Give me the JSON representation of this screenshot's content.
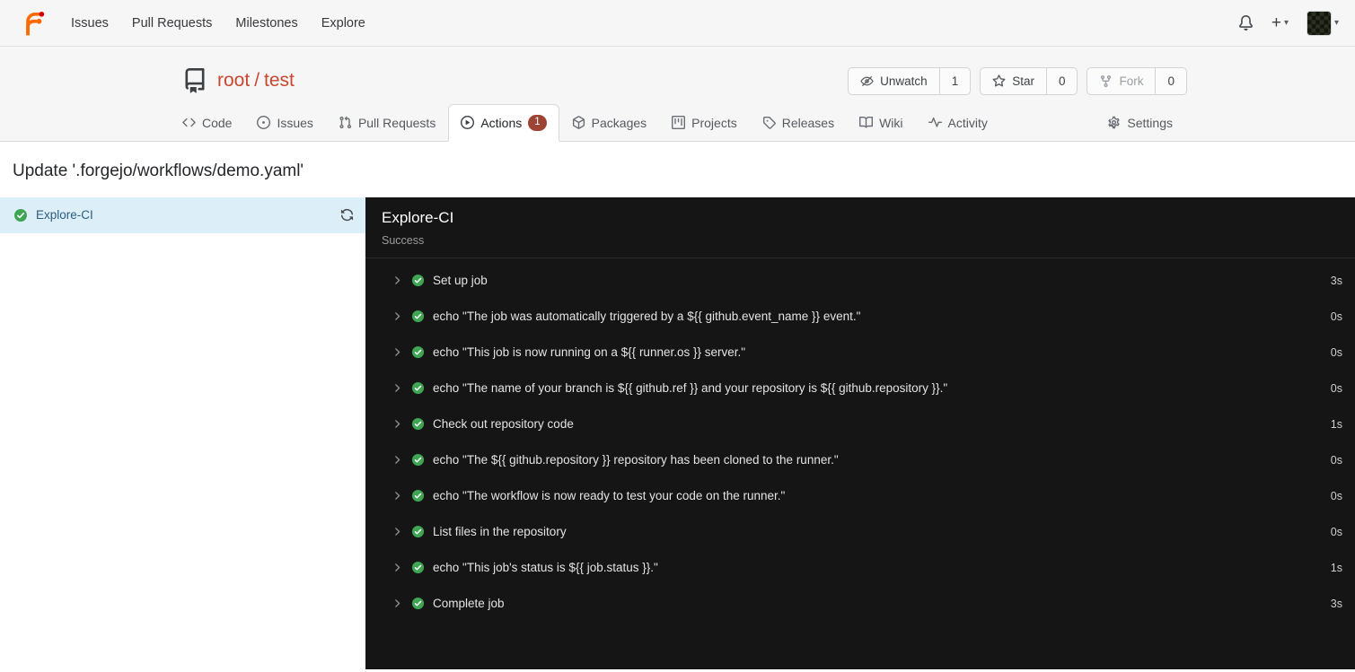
{
  "colors": {
    "accent": "#c8472f",
    "success_green": "#3fa553",
    "selected_job_bg": "#dceff9",
    "log_panel_bg": "#151515"
  },
  "icons": {
    "plus": "+",
    "caret_down": "▾"
  },
  "navbar": {
    "items": [
      {
        "label": "Issues"
      },
      {
        "label": "Pull Requests"
      },
      {
        "label": "Milestones"
      },
      {
        "label": "Explore"
      }
    ]
  },
  "repo_header": {
    "owner": "root",
    "slash": "/",
    "name": "test",
    "buttons": [
      {
        "label": "Unwatch",
        "count": "1"
      },
      {
        "label": "Star",
        "count": "0"
      },
      {
        "label": "Fork",
        "count": "0",
        "disabled": true
      }
    ],
    "tabs": [
      {
        "label": "Code"
      },
      {
        "label": "Issues"
      },
      {
        "label": "Pull Requests"
      },
      {
        "label": "Actions",
        "badge": "1",
        "active": true
      },
      {
        "label": "Packages"
      },
      {
        "label": "Projects"
      },
      {
        "label": "Releases"
      },
      {
        "label": "Wiki"
      },
      {
        "label": "Activity"
      },
      {
        "label": "Settings"
      }
    ]
  },
  "run": {
    "title": "Update '.forgejo/workflows/demo.yaml'",
    "jobs": [
      {
        "name": "Explore-CI",
        "status": "success"
      }
    ],
    "job_detail": {
      "title": "Explore-CI",
      "status": "Success",
      "steps": [
        {
          "name": "Set up job",
          "duration": "3s"
        },
        {
          "name": "echo \"The job was automatically triggered by a ${{ github.event_name }} event.\"",
          "duration": "0s"
        },
        {
          "name": "echo \"This job is now running on a ${{ runner.os }} server.\"",
          "duration": "0s"
        },
        {
          "name": "echo \"The name of your branch is ${{ github.ref }} and your repository is ${{ github.repository }}.\"",
          "duration": "0s"
        },
        {
          "name": "Check out repository code",
          "duration": "1s"
        },
        {
          "name": "echo \"The ${{ github.repository }} repository has been cloned to the runner.\"",
          "duration": "0s"
        },
        {
          "name": "echo \"The workflow is now ready to test your code on the runner.\"",
          "duration": "0s"
        },
        {
          "name": "List files in the repository",
          "duration": "0s"
        },
        {
          "name": "echo \"This job's status is ${{ job.status }}.\"",
          "duration": "1s"
        },
        {
          "name": "Complete job",
          "duration": "3s"
        }
      ]
    }
  }
}
